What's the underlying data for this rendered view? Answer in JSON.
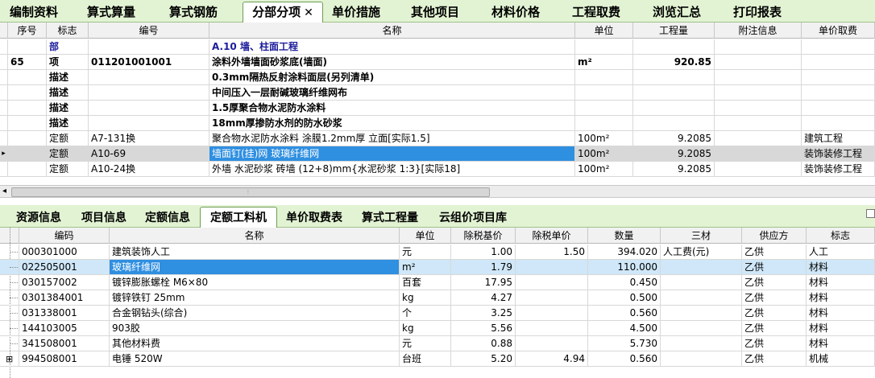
{
  "top_tabs": [
    {
      "label": "编制资料",
      "active": false
    },
    {
      "label": "算式算量",
      "active": false
    },
    {
      "label": "算式钢筋",
      "active": false
    },
    {
      "label": "分部分项",
      "active": true
    },
    {
      "label": "单价措施",
      "active": false
    },
    {
      "label": "其他项目",
      "active": false
    },
    {
      "label": "材料价格",
      "active": false
    },
    {
      "label": "工程取费",
      "active": false
    },
    {
      "label": "浏览汇总",
      "active": false
    },
    {
      "label": "打印报表",
      "active": false
    }
  ],
  "close_glyph": "✕",
  "upper_grid": {
    "headers": [
      "序号",
      "标志",
      "编号",
      "名称",
      "单位",
      "工程量",
      "附注信息",
      "单价取费"
    ],
    "rows": [
      {
        "seq": "",
        "flag": "部",
        "code": "",
        "name": "A.10 墙、柱面工程",
        "unit": "",
        "qty": "",
        "note": "",
        "fee": "",
        "style": "bluebold"
      },
      {
        "seq": "65",
        "flag": "项",
        "code": "011201001001",
        "name": "涂料外墙墙面砂浆底(墙面)",
        "unit": "m²",
        "qty": "920.85",
        "note": "",
        "fee": "",
        "style": "bold"
      },
      {
        "seq": "",
        "flag": "描述",
        "code": "",
        "name": "0.3mm隔热反射涂料面层(另列清单)",
        "unit": "",
        "qty": "",
        "note": "",
        "fee": "",
        "style": "bold"
      },
      {
        "seq": "",
        "flag": "描述",
        "code": "",
        "name": "中间压入一层耐碱玻璃纤维网布",
        "unit": "",
        "qty": "",
        "note": "",
        "fee": "",
        "style": "bold"
      },
      {
        "seq": "",
        "flag": "描述",
        "code": "",
        "name": "1.5厚聚合物水泥防水涂料",
        "unit": "",
        "qty": "",
        "note": "",
        "fee": "",
        "style": "bold"
      },
      {
        "seq": "",
        "flag": "描述",
        "code": "",
        "name": "18mm厚掺防水剂的防水砂浆",
        "unit": "",
        "qty": "",
        "note": "",
        "fee": "",
        "style": "bold"
      },
      {
        "seq": "",
        "flag": "定额",
        "code": "A7-131换",
        "name": "聚合物水泥防水涂料 涂膜1.2mm厚 立面[实际1.5]",
        "unit": "100m²",
        "qty": "9.2085",
        "note": "",
        "fee": "建筑工程",
        "style": ""
      },
      {
        "seq": "",
        "flag": "定额",
        "code": "A10-69",
        "name": "墙面钉(挂)网 玻璃纤维网",
        "unit": "100m²",
        "qty": "9.2085",
        "note": "",
        "fee": "装饰装修工程",
        "style": "sel"
      },
      {
        "seq": "",
        "flag": "定额",
        "code": "A10-24换",
        "name": "外墙 水泥砂浆 砖墙 (12+8)mm{水泥砂浆 1:3}[实际18]",
        "unit": "100m²",
        "qty": "9.2085",
        "note": "",
        "fee": "装饰装修工程",
        "style": ""
      }
    ]
  },
  "bottom_tabs": [
    {
      "label": "资源信息",
      "active": false
    },
    {
      "label": "项目信息",
      "active": false
    },
    {
      "label": "定额信息",
      "active": false
    },
    {
      "label": "定额工料机",
      "active": true
    },
    {
      "label": "单价取费表",
      "active": false
    },
    {
      "label": "算式工程量",
      "active": false
    },
    {
      "label": "云组价项目库",
      "active": false
    }
  ],
  "lower_grid": {
    "headers": [
      "编码",
      "名称",
      "单位",
      "除税基价",
      "除税单价",
      "数量",
      "三材",
      "供应方",
      "标志"
    ],
    "rows": [
      {
        "code": "000301000",
        "name": "建筑装饰人工",
        "unit": "元",
        "base": "1.00",
        "price": "1.50",
        "qty": "394.020",
        "mat": "人工费(元)",
        "supplier": "乙供",
        "flag": "人工",
        "selected": false
      },
      {
        "code": "022505001",
        "name": "玻璃纤维网",
        "unit": "m²",
        "base": "1.79",
        "price": "",
        "qty": "110.000",
        "mat": "",
        "supplier": "乙供",
        "flag": "材料",
        "selected": true
      },
      {
        "code": "030157002",
        "name": "镀锌膨胀螺栓 M6×80",
        "unit": "百套",
        "base": "17.95",
        "price": "",
        "qty": "0.450",
        "mat": "",
        "supplier": "乙供",
        "flag": "材料",
        "selected": false
      },
      {
        "code": "0301384001",
        "name": "镀锌铁钉 25mm",
        "unit": "kg",
        "base": "4.27",
        "price": "",
        "qty": "0.500",
        "mat": "",
        "supplier": "乙供",
        "flag": "材料",
        "selected": false
      },
      {
        "code": "031338001",
        "name": "合金钢钻头(综合)",
        "unit": "个",
        "base": "3.25",
        "price": "",
        "qty": "0.560",
        "mat": "",
        "supplier": "乙供",
        "flag": "材料",
        "selected": false
      },
      {
        "code": "144103005",
        "name": "903胶",
        "unit": "kg",
        "base": "5.56",
        "price": "",
        "qty": "4.500",
        "mat": "",
        "supplier": "乙供",
        "flag": "材料",
        "selected": false
      },
      {
        "code": "341508001",
        "name": "其他材料费",
        "unit": "元",
        "base": "0.88",
        "price": "",
        "qty": "5.730",
        "mat": "",
        "supplier": "乙供",
        "flag": "材料",
        "selected": false
      },
      {
        "code": "994508001",
        "name": "电锤 520W",
        "unit": "台班",
        "base": "5.20",
        "price": "4.94",
        "qty": "0.560",
        "mat": "",
        "supplier": "乙供",
        "flag": "机械",
        "selected": false
      }
    ]
  }
}
